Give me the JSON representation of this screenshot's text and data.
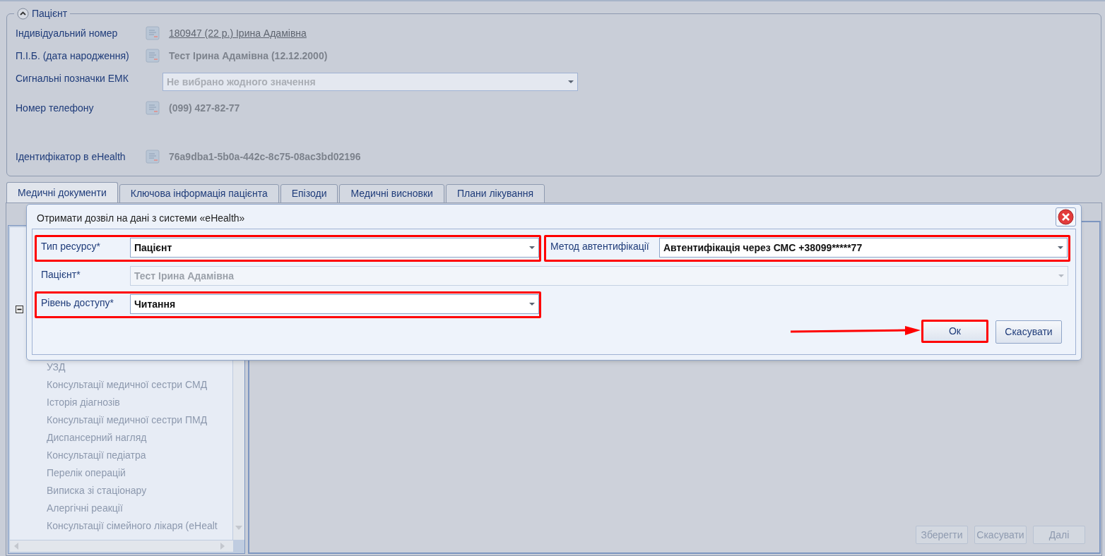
{
  "patient_panel": {
    "title": "Пацієнт",
    "expanded": true,
    "fields": [
      {
        "kind": "link",
        "label": "Індивідуальний номер",
        "value": "180947 (22 р.) Ірина Адамівна"
      },
      {
        "kind": "text",
        "label": "П.І.Б. (дата народження)",
        "value": "Тест Ірина Адамівна (12.12.2000)"
      },
      {
        "kind": "select",
        "label": "Сигнальні позначки ЕМК",
        "placeholder": "Не вибрано жодного значення"
      },
      {
        "kind": "text",
        "label": "Номер телефону",
        "value": "(099) 427-82-77"
      },
      {
        "kind": "text",
        "label": "Ідентифікатор в eHealth",
        "value": "76a9dba1-5b0a-442c-8c75-08ac3bd02196"
      }
    ]
  },
  "tabs": [
    {
      "label": "Медичні документи",
      "selected": true
    },
    {
      "label": "Ключова інформація пацієнта",
      "selected": false
    },
    {
      "label": "Епізоди",
      "selected": false
    },
    {
      "label": "Медичні висновки",
      "selected": false
    },
    {
      "label": "Плани лікування",
      "selected": false
    }
  ],
  "tree": {
    "expanded": true,
    "items": [
      "УЗД",
      "Консультації медичної сестри СМД",
      "Історія діагнозів",
      "Консультації медичної сестри ПМД",
      "Диспансерний нагляд",
      "Консультації педіатра",
      "Перелік операцій",
      "Виписка зі стаціонару",
      "Алергічні реакції",
      "Консультації сімейного лікаря (eHealt"
    ]
  },
  "footer_buttons": [
    {
      "label": "Зберегти",
      "disabled": true
    },
    {
      "label": "Скасувати",
      "disabled": true
    },
    {
      "label": "Далі",
      "disabled": true
    }
  ],
  "dialog": {
    "title": "Отримати дозвіл на дані з системи «eHealth»",
    "fields": [
      {
        "label": "Тип ресурсу*",
        "value": "Пацієнт",
        "disabled": false,
        "highlighted": true
      },
      {
        "label": "Метод автентифікації",
        "value": "Автентифікація через СМС  +38099*****77",
        "disabled": false,
        "highlighted": true
      },
      {
        "label": "Пацієнт*",
        "value": "Тест Ірина Адамівна",
        "disabled": true,
        "highlighted": false
      },
      {
        "label": "Рівень доступу*",
        "value": "Читання",
        "disabled": false,
        "highlighted": true
      }
    ],
    "buttons": [
      {
        "label": "Ок",
        "highlighted": true,
        "pointed": true
      },
      {
        "label": "Скасувати",
        "highlighted": false,
        "pointed": false
      }
    ]
  }
}
